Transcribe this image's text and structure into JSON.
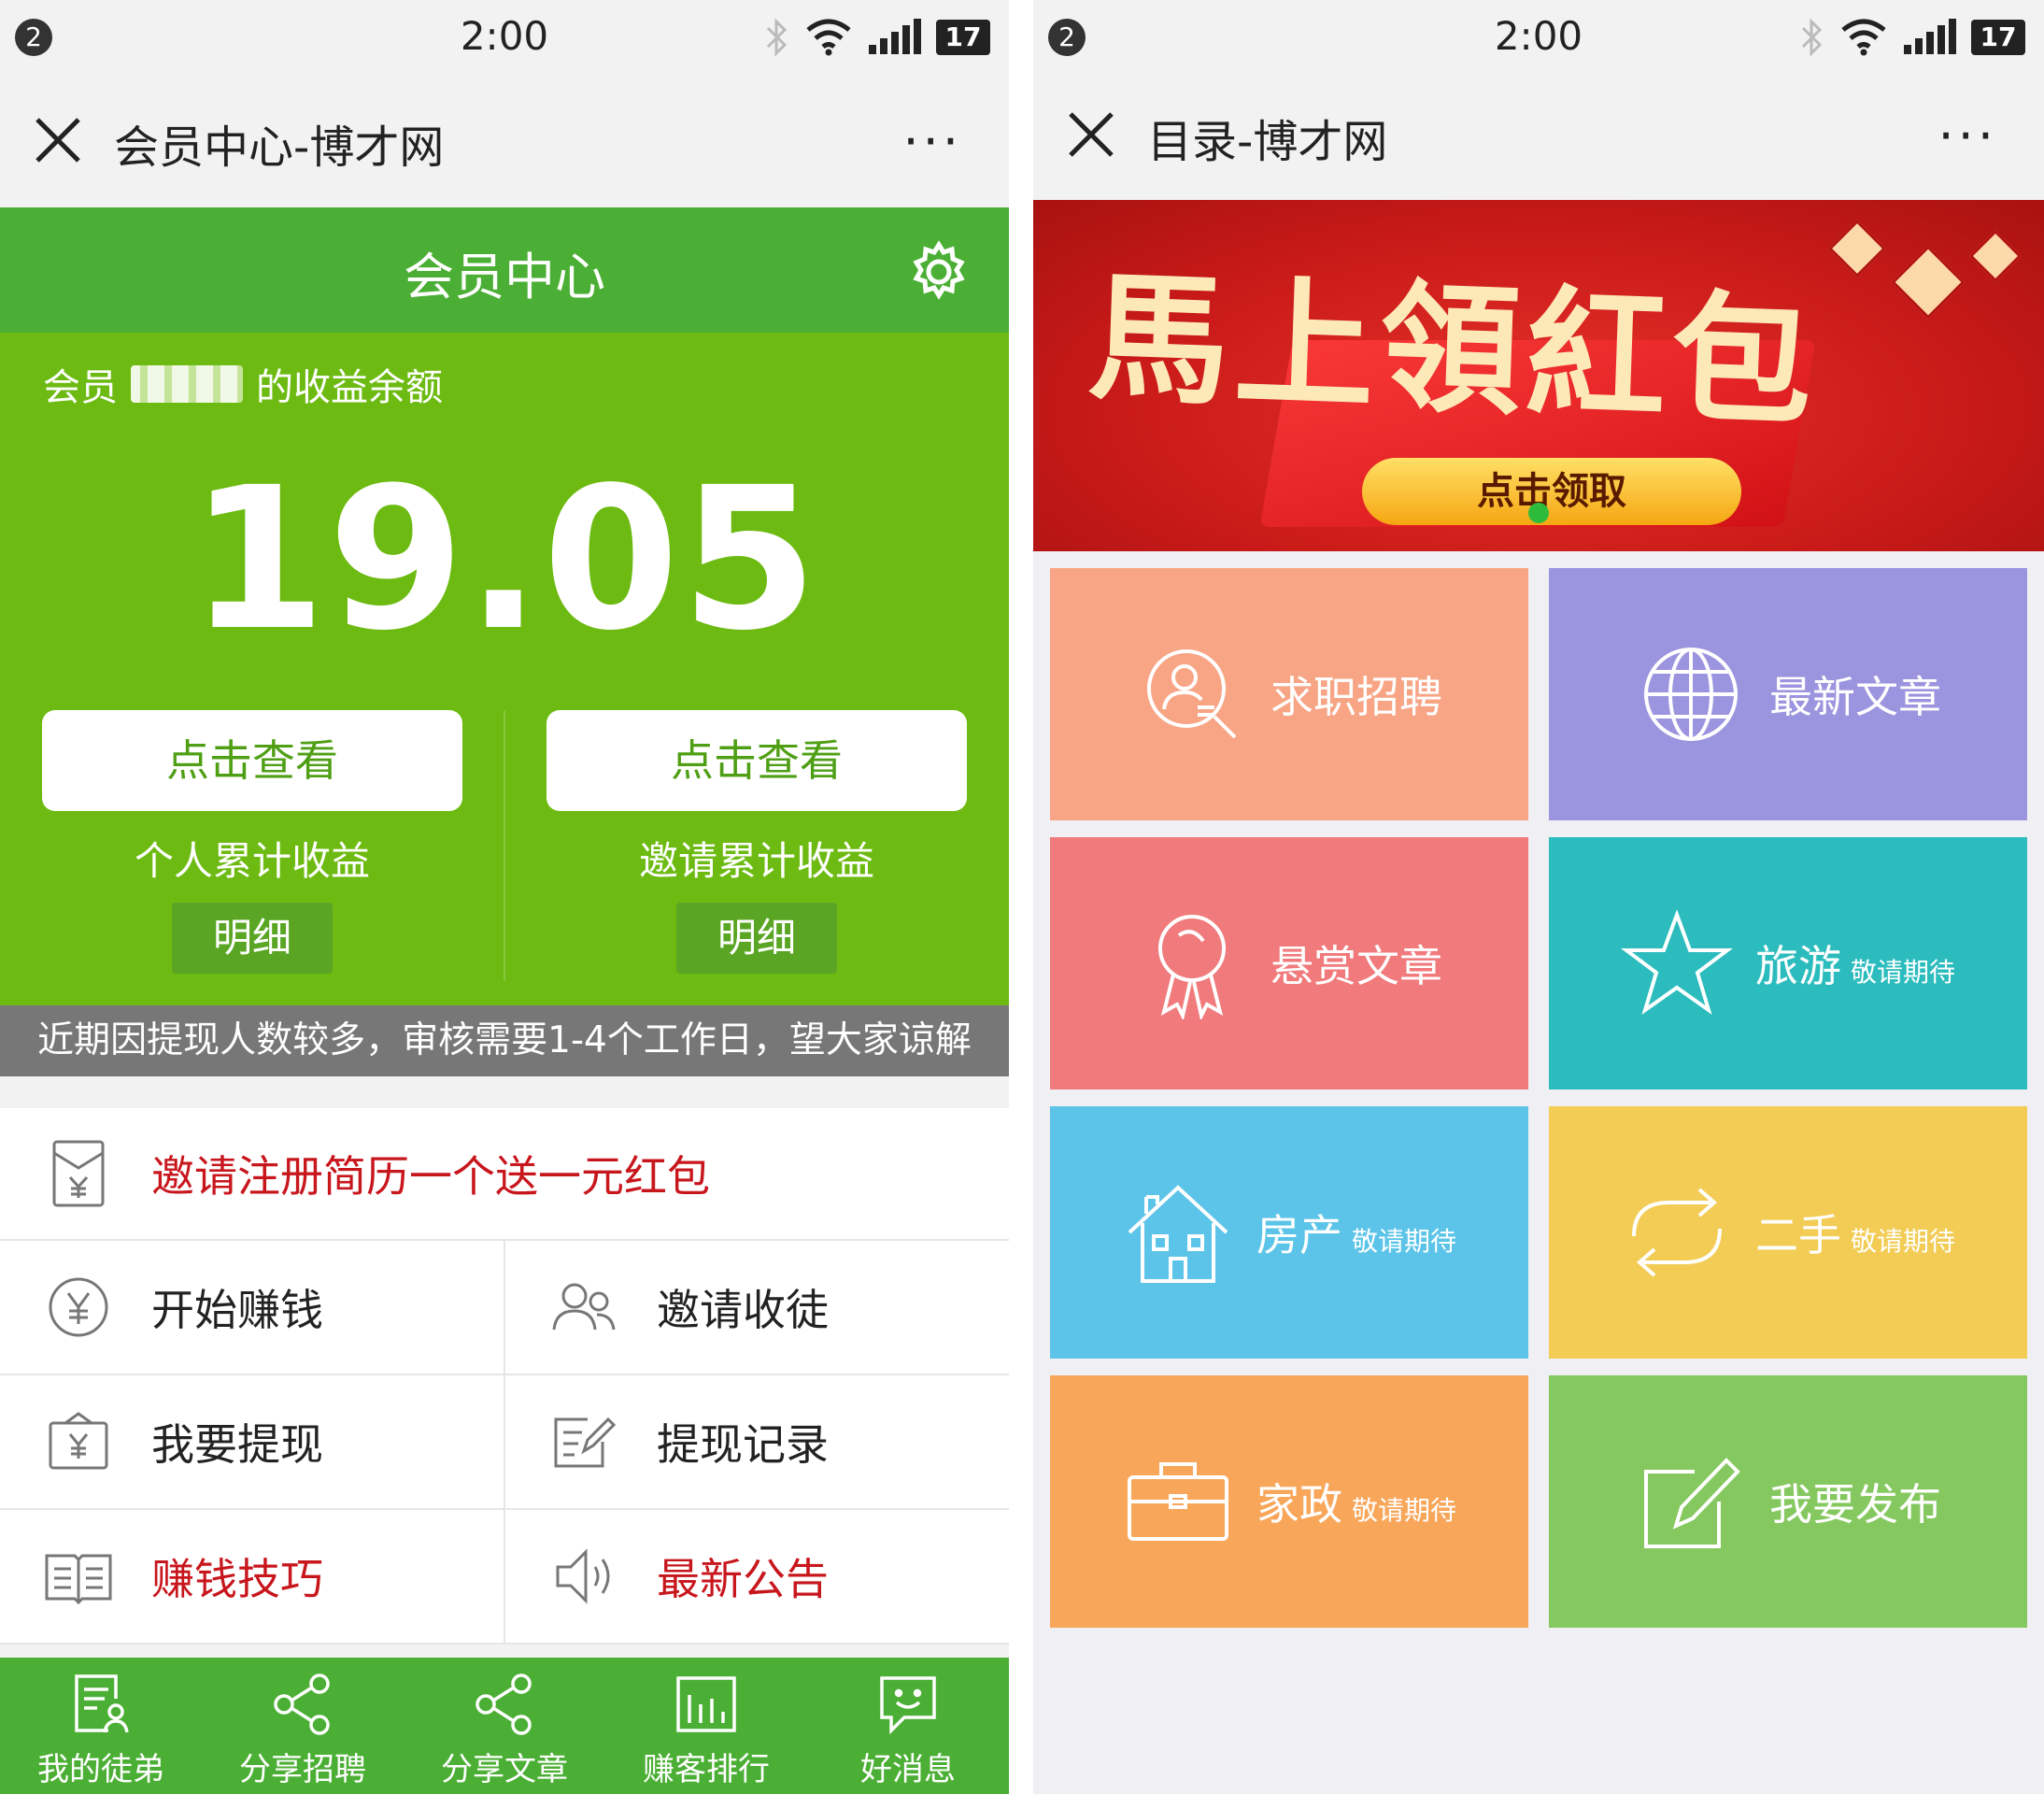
{
  "left": {
    "status": {
      "badge": "2",
      "time": "2:00",
      "battery": "17"
    },
    "titlebar": {
      "title": "会员中心-博才网",
      "more": "···"
    },
    "header": {
      "title": "会员中心"
    },
    "balance": {
      "label_prefix": "会员",
      "label_suffix": "的收益余额",
      "value": "19.05"
    },
    "earnings": [
      {
        "button": "点击查看",
        "label": "个人累计收益",
        "detail": "明细"
      },
      {
        "button": "点击查看",
        "label": "邀请累计收益",
        "detail": "明细"
      }
    ],
    "notice": "近期因提现人数较多，审核需要1-4个工作日，望大家谅解",
    "menu": {
      "invite_banner": {
        "label": "邀请注册简历一个送一元红包",
        "icon": "red-envelope-yen-icon"
      },
      "rows": [
        [
          {
            "label": "开始赚钱",
            "icon": "yen-coin-icon",
            "red": false
          },
          {
            "label": "邀请收徒",
            "icon": "users-icon",
            "red": false
          }
        ],
        [
          {
            "label": "我要提现",
            "icon": "wallet-yen-icon",
            "red": false
          },
          {
            "label": "提现记录",
            "icon": "edit-record-icon",
            "red": false
          }
        ],
        [
          {
            "label": "赚钱技巧",
            "icon": "open-book-icon",
            "red": true
          },
          {
            "label": "最新公告",
            "icon": "speaker-icon",
            "red": true
          }
        ]
      ]
    },
    "tabbar": [
      {
        "label": "我的徒弟",
        "icon": "document-user-icon"
      },
      {
        "label": "分享招聘",
        "icon": "share-icon"
      },
      {
        "label": "分享文章",
        "icon": "share-icon"
      },
      {
        "label": "赚客排行",
        "icon": "bar-chart-icon"
      },
      {
        "label": "好消息",
        "icon": "chat-smile-icon"
      }
    ],
    "colors": {
      "green_dark": "#4caf35",
      "green": "#6dbb12",
      "red": "#c8161d",
      "notice_bg": "#777777"
    }
  },
  "right": {
    "status": {
      "badge": "2",
      "time": "2:00",
      "battery": "17"
    },
    "titlebar": {
      "title": "目录-博才网",
      "more": "···"
    },
    "banner": {
      "title": "馬上領紅包",
      "button": "点击领取"
    },
    "tiles": [
      {
        "label": "求职招聘",
        "sub": "",
        "icon": "search-user-icon",
        "color": "#f8a585"
      },
      {
        "label": "最新文章",
        "sub": "",
        "icon": "globe-icon",
        "color": "#9b94de"
      },
      {
        "label": "悬赏文章",
        "sub": "",
        "icon": "award-ribbon-icon",
        "color": "#f07a7c"
      },
      {
        "label": "旅游",
        "sub": "敬请期待",
        "icon": "star-icon",
        "color": "#2cbcbe"
      },
      {
        "label": "房产",
        "sub": "敬请期待",
        "icon": "house-icon",
        "color": "#5bc4e8"
      },
      {
        "label": "二手",
        "sub": "敬请期待",
        "icon": "recycle-icon",
        "color": "#f2cc55"
      },
      {
        "label": "家政",
        "sub": "敬请期待",
        "icon": "briefcase-icon",
        "color": "#f8a65a"
      },
      {
        "label": "我要发布",
        "sub": "",
        "icon": "edit-post-icon",
        "color": "#86c860"
      }
    ]
  }
}
